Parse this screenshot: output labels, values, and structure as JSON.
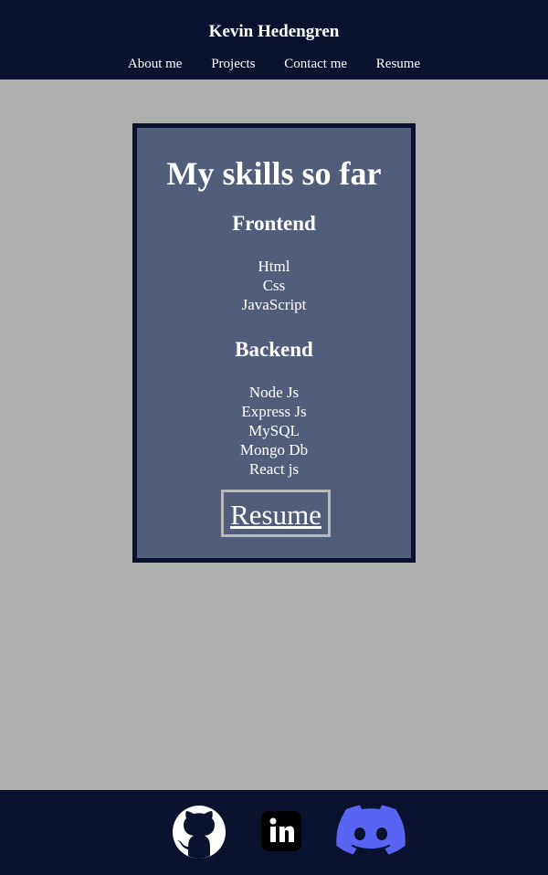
{
  "header": {
    "title": "Kevin Hedengren",
    "nav": [
      "About me",
      "Projects",
      "Contact me",
      "Resume"
    ]
  },
  "skills": {
    "title": "My skills so far",
    "frontend_heading": "Frontend",
    "frontend": [
      "Html",
      "Css",
      "JavaScript"
    ],
    "backend_heading": "Backend",
    "backend": [
      "Node Js",
      "Express Js",
      "MySQL",
      "Mongo Db",
      "React js"
    ],
    "resume_button": "Resume"
  },
  "footer": {
    "icons": [
      "github-icon",
      "linkedin-icon",
      "discord-icon"
    ]
  },
  "colors": {
    "header_bg": "#0a1230",
    "page_bg": "#afafaf",
    "card_bg": "#525d7b",
    "discord": "#5865f2"
  }
}
